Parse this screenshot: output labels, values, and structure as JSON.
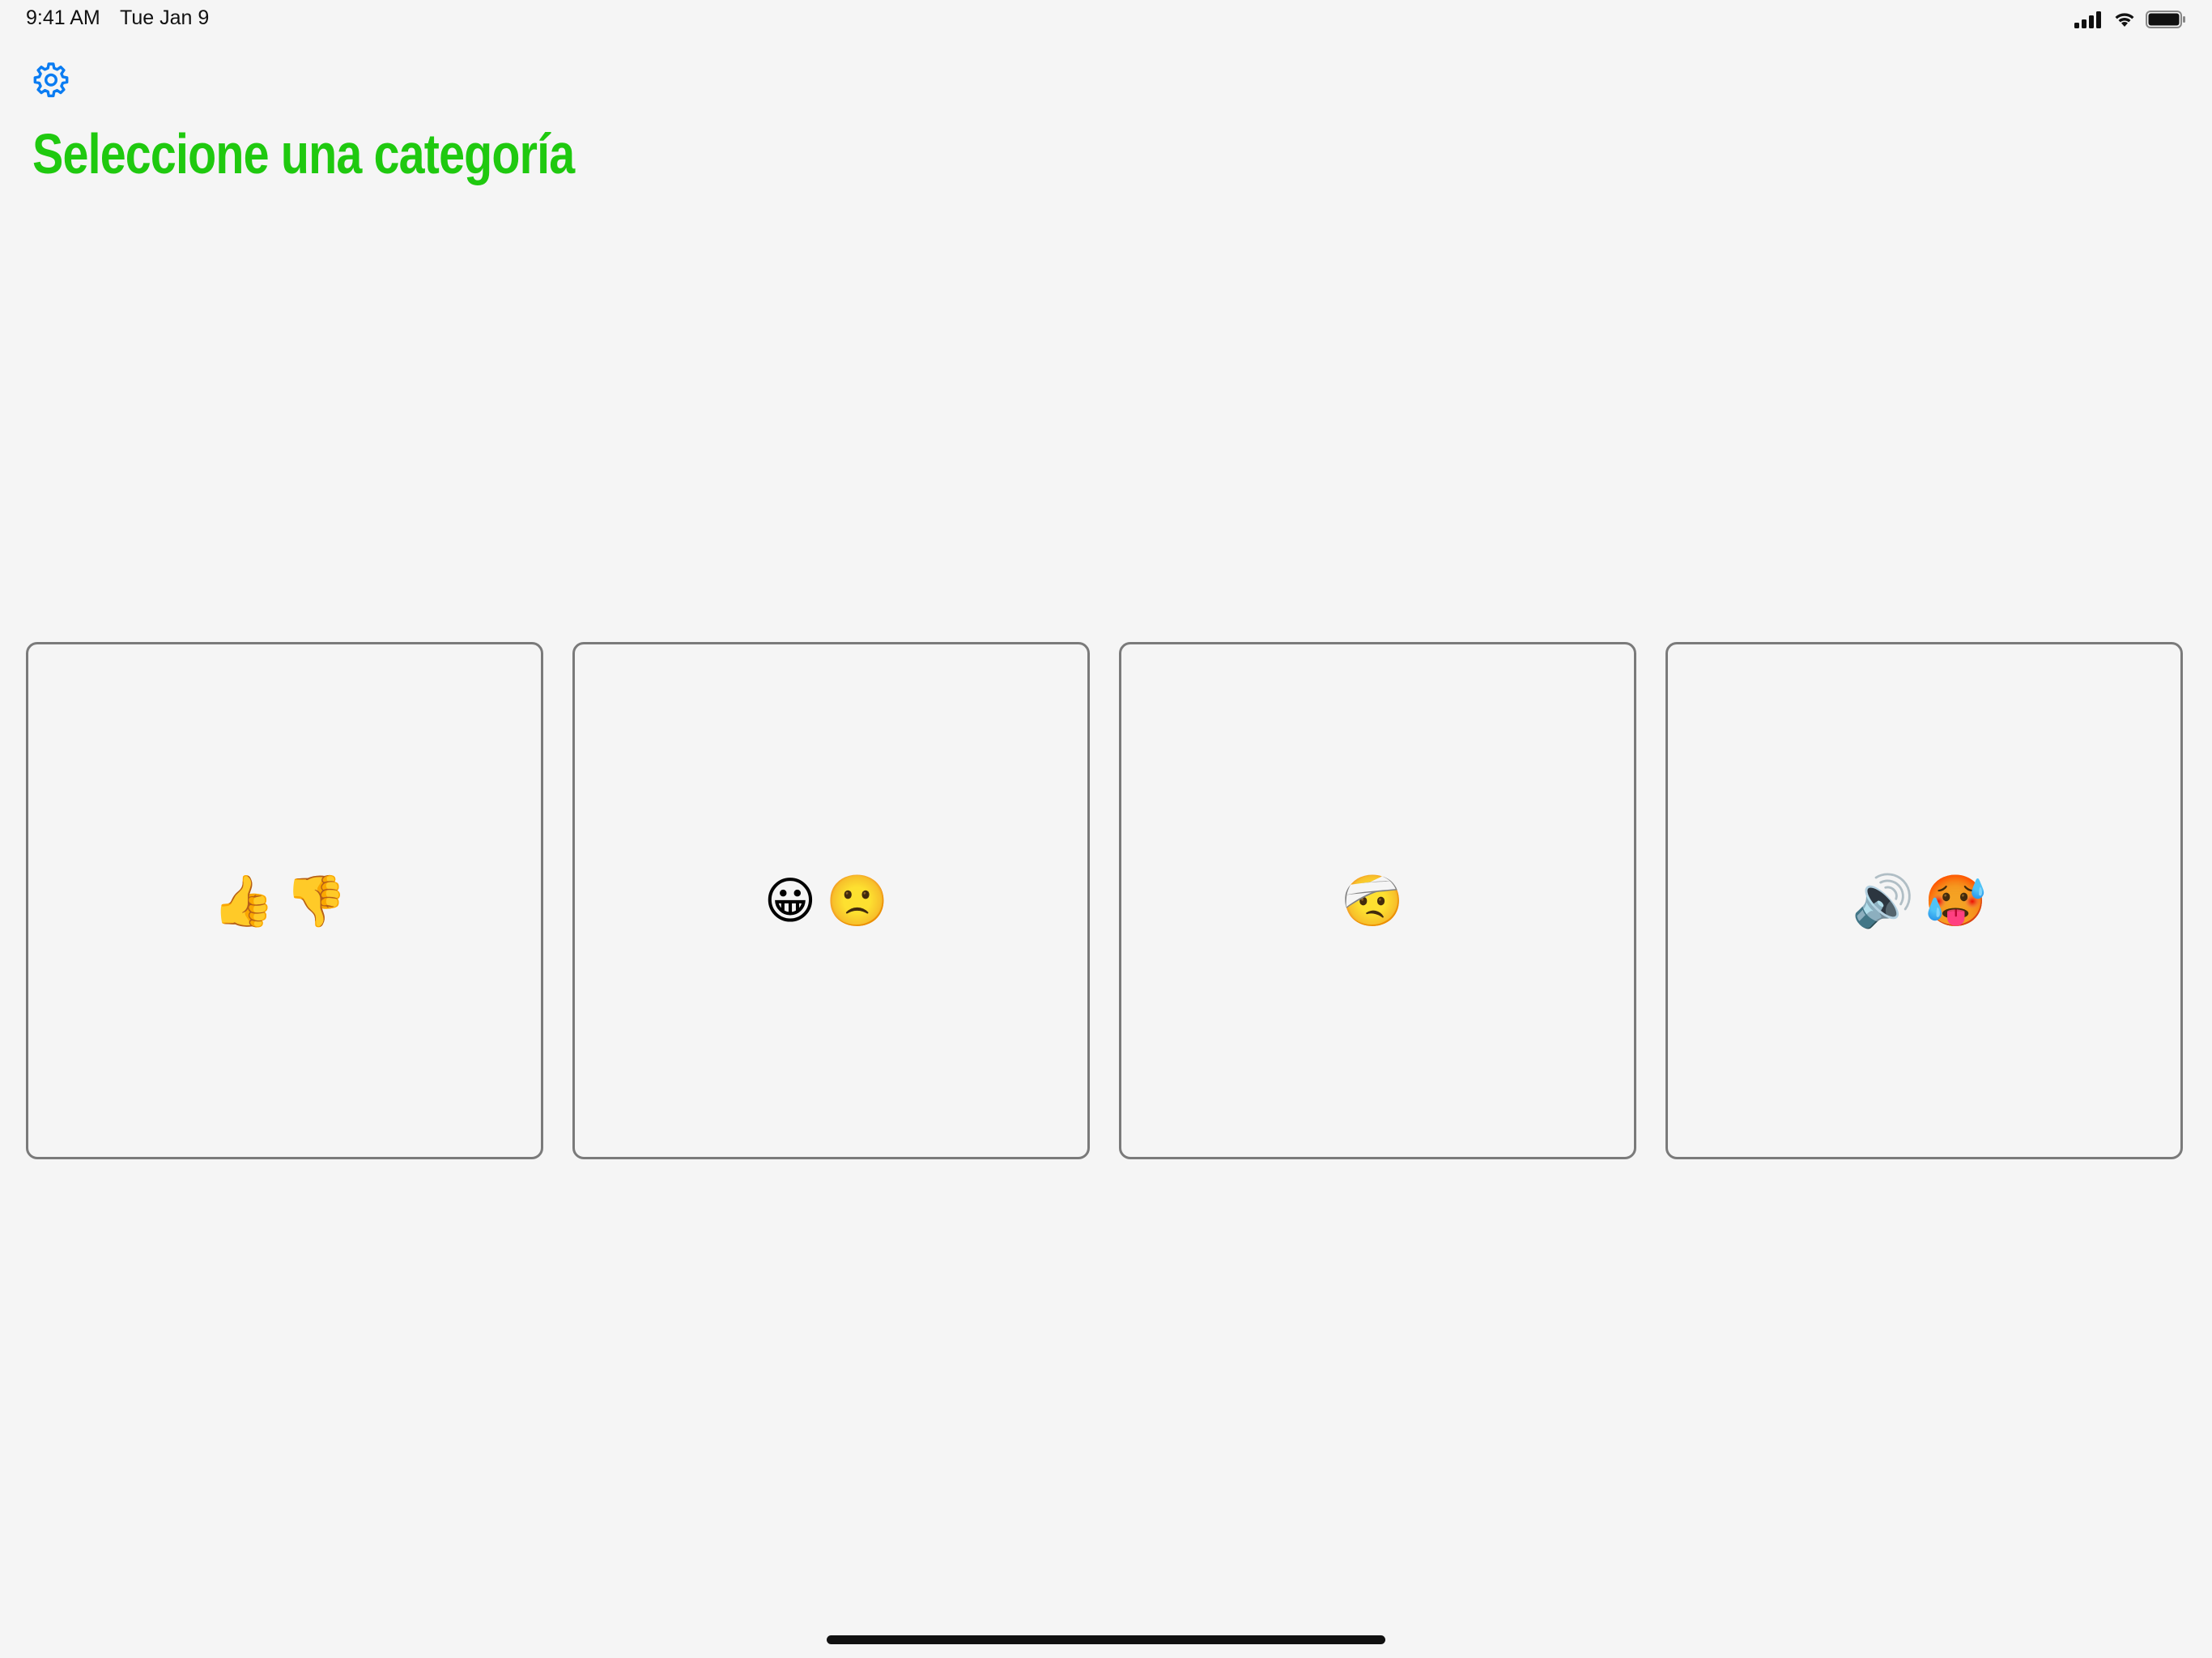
{
  "status_bar": {
    "time": "9:41 AM",
    "date": "Tue Jan 9"
  },
  "header": {
    "settings_icon": "gear-icon",
    "title": "Seleccione una categoría"
  },
  "categories": [
    {
      "emoji": "👍👎",
      "icons": [
        "thumbs-up-icon",
        "thumbs-down-icon"
      ]
    },
    {
      "emoji": "😀🙁",
      "icons": [
        "grinning-face-icon",
        "frowning-face-icon"
      ]
    },
    {
      "emoji": "🤕",
      "icons": [
        "head-bandage-face-icon"
      ]
    },
    {
      "emoji": "🔊🥵",
      "icons": [
        "speaker-high-volume-icon",
        "hot-face-icon"
      ]
    }
  ],
  "colors": {
    "title": "#1fc90f",
    "accent": "#0a7cf2",
    "background": "#f5f5f5",
    "card_border": "#7a7a7a"
  }
}
